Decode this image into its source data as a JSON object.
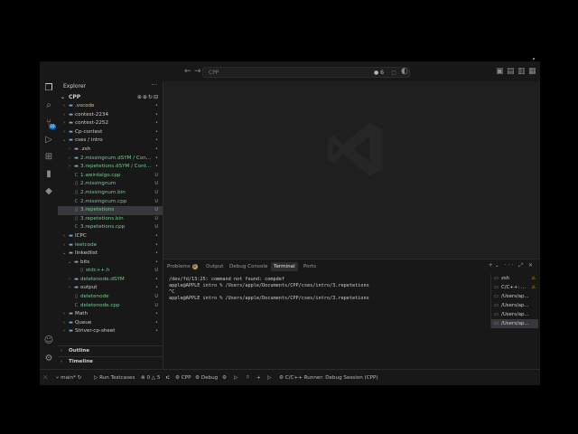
{
  "titlebar": {
    "search_text": "CPP",
    "copilot_count": "6"
  },
  "activity": {
    "scm_badge": "10"
  },
  "explorer": {
    "header": "Explorer",
    "root": "CPP",
    "items": [
      {
        "label": ".vscode",
        "type": "folder",
        "depth": 1,
        "expanded": false,
        "color": "mod",
        "status": ""
      },
      {
        "label": "contest-2234",
        "type": "folder",
        "depth": 1,
        "expanded": false,
        "color": "def",
        "status": ""
      },
      {
        "label": "contest-2252",
        "type": "folder",
        "depth": 1,
        "expanded": false,
        "color": "def",
        "status": ""
      },
      {
        "label": "Cp-contest",
        "type": "folder",
        "depth": 1,
        "expanded": false,
        "color": "def",
        "status": ""
      },
      {
        "label": "cses / intro",
        "type": "folder",
        "depth": 1,
        "expanded": true,
        "color": "def",
        "status": ""
      },
      {
        "label": ".zsh",
        "type": "folder",
        "depth": 2,
        "expanded": false,
        "color": "def",
        "status": ""
      },
      {
        "label": "2.missingnum.dSYM / Con...",
        "type": "folder",
        "depth": 2,
        "expanded": false,
        "color": "unt",
        "status": ""
      },
      {
        "label": "3.repetetions.dSYM / Cont...",
        "type": "folder",
        "depth": 2,
        "expanded": false,
        "color": "unt",
        "status": ""
      },
      {
        "label": "1.weirdalgo.cpp",
        "type": "cpp",
        "depth": 2,
        "color": "unt",
        "status": "U"
      },
      {
        "label": "2.missingnum",
        "type": "file",
        "depth": 2,
        "color": "unt",
        "status": "U"
      },
      {
        "label": "2.missingnum.bin",
        "type": "file",
        "depth": 2,
        "color": "unt",
        "status": "U"
      },
      {
        "label": "2.missingnum.cpp",
        "type": "cpp",
        "depth": 2,
        "color": "unt",
        "status": "U"
      },
      {
        "label": "3.repetetions",
        "type": "file",
        "depth": 2,
        "color": "unt",
        "status": "U",
        "selected": true
      },
      {
        "label": "3.repetetions.bin",
        "type": "file",
        "depth": 2,
        "color": "unt",
        "status": "U"
      },
      {
        "label": "3.repetetions.cpp",
        "type": "cpp",
        "depth": 2,
        "color": "unt",
        "status": "U"
      },
      {
        "label": "ICPC",
        "type": "folder",
        "depth": 1,
        "expanded": false,
        "color": "def",
        "status": ""
      },
      {
        "label": "leetcode",
        "type": "folder",
        "depth": 1,
        "expanded": false,
        "color": "unt",
        "status": ""
      },
      {
        "label": "linkedlist",
        "type": "folder",
        "depth": 1,
        "expanded": true,
        "color": "def",
        "status": ""
      },
      {
        "label": "bits",
        "type": "folder",
        "depth": 2,
        "expanded": true,
        "color": "def",
        "status": ""
      },
      {
        "label": "stdc++.h",
        "type": "file",
        "depth": 3,
        "color": "unt",
        "status": "U"
      },
      {
        "label": "deletenode.dSYM",
        "type": "folder",
        "depth": 2,
        "expanded": false,
        "color": "unt",
        "status": ""
      },
      {
        "label": "output",
        "type": "folder",
        "depth": 2,
        "expanded": false,
        "color": "def",
        "status": ""
      },
      {
        "label": "deletenode",
        "type": "file",
        "depth": 2,
        "color": "unt",
        "status": "U"
      },
      {
        "label": "deletenode.cpp",
        "type": "cpp",
        "depth": 2,
        "color": "unt",
        "status": "U"
      },
      {
        "label": "Math",
        "type": "folder",
        "depth": 1,
        "expanded": false,
        "color": "def",
        "status": ""
      },
      {
        "label": "Queue",
        "type": "folder",
        "depth": 1,
        "expanded": false,
        "color": "def",
        "status": ""
      },
      {
        "label": "Striver-cp-sheet",
        "type": "folder",
        "depth": 1,
        "expanded": false,
        "color": "def",
        "status": ""
      }
    ],
    "outline": "Outline",
    "timeline": "Timeline"
  },
  "panel": {
    "tabs": [
      {
        "label": "Problems",
        "count": "8"
      },
      {
        "label": "Output"
      },
      {
        "label": "Debug Console"
      },
      {
        "label": "Terminal",
        "active": true
      },
      {
        "label": "Ports"
      }
    ],
    "terminal_lines": [
      "/dev/fd/13:25: command not found: compdef",
      "apple@APPLE intro % /Users/apple/Documents/CPP/cses/intro/3.repetetions",
      "^C",
      "apple@APPLE intro % /Users/apple/Documents/CPP/cses/intro/3.repetetions"
    ],
    "terminals": [
      {
        "label": "zsh",
        "warn": true
      },
      {
        "label": "C/C++: ...",
        "warn": true
      },
      {
        "label": "/Users/ap...",
        "warn": false
      },
      {
        "label": "/Users/ap...",
        "warn": false
      },
      {
        "label": "/Users/ap...",
        "warn": false
      },
      {
        "label": "/Users/ap...",
        "warn": false,
        "active": true
      }
    ]
  },
  "statusbar": {
    "branch": "main*",
    "run_tests": "Run Testcases",
    "errors": "0",
    "warnings": "5",
    "lang": "CPP",
    "debug": "Debug",
    "runner": "C/C++ Runner: Debug Session (CPP)"
  }
}
